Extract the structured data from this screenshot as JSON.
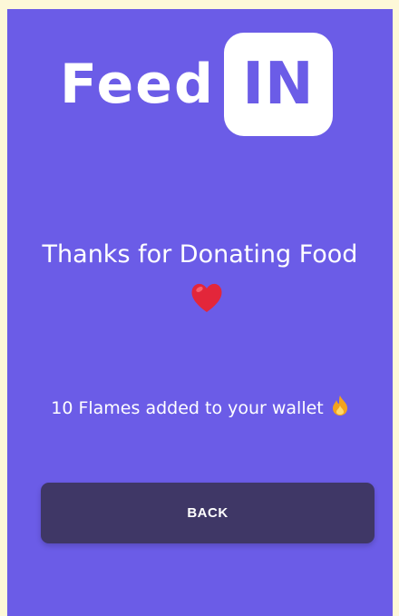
{
  "logo": {
    "text_feed": "Feed",
    "text_in": "IN"
  },
  "message": {
    "thanks": "Thanks for Donating Food",
    "wallet": "10 Flames added to your wallet"
  },
  "icons": {
    "heart": "heart-icon",
    "flame": "flame-icon"
  },
  "buttons": {
    "back_label": "BACK"
  },
  "colors": {
    "background": "#6b5ce7",
    "button": "#3f3766",
    "text": "#ffffff",
    "heart": "#e3263a",
    "flame": "#f4a21c"
  }
}
